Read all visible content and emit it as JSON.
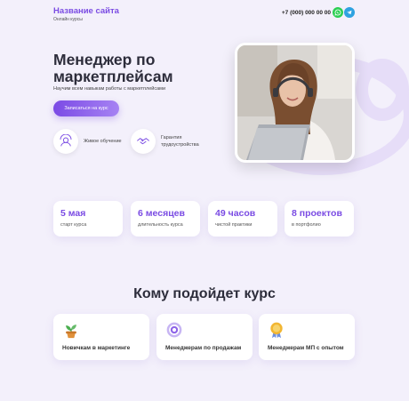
{
  "header": {
    "site_title": "Название сайта",
    "site_subtitle": "Онлайн курсы",
    "phone": "+7 (000) 000 00 00",
    "messengers": [
      {
        "icon": "whatsapp-icon",
        "color": "#2bcf52"
      },
      {
        "icon": "telegram-icon",
        "color": "#2ea2e0"
      }
    ]
  },
  "hero": {
    "title": "Менеджер по маркетплейсам",
    "subtitle": "Научим всем навыкам работы с маркетплейсами",
    "cta_label": "Записаться на курс",
    "features": [
      {
        "icon": "live-learning-icon",
        "label": "Живое обучение"
      },
      {
        "icon": "handshake-icon",
        "label": "Гарантия трудоустройства"
      }
    ],
    "photo_alt": "Девушка в наушниках за ноутбуком"
  },
  "stats": [
    {
      "value": "5 мая",
      "label": "старт курса"
    },
    {
      "value": "6 месяцев",
      "label": "длительность курса"
    },
    {
      "value": "49 часов",
      "label": "чистой практики"
    },
    {
      "value": "8 проектов",
      "label": "в портфолио"
    }
  ],
  "audience": {
    "title": "Кому подойдет курс",
    "items": [
      {
        "icon": "sprout-icon",
        "label": "Новичкам в маркетинге"
      },
      {
        "icon": "target-icon",
        "label": "Менеджерам по продажам"
      },
      {
        "icon": "medal-icon",
        "label": "Менеджерам МП с опытом"
      }
    ]
  },
  "colors": {
    "accent": "#7a4be3",
    "background": "#f3f0fb"
  }
}
